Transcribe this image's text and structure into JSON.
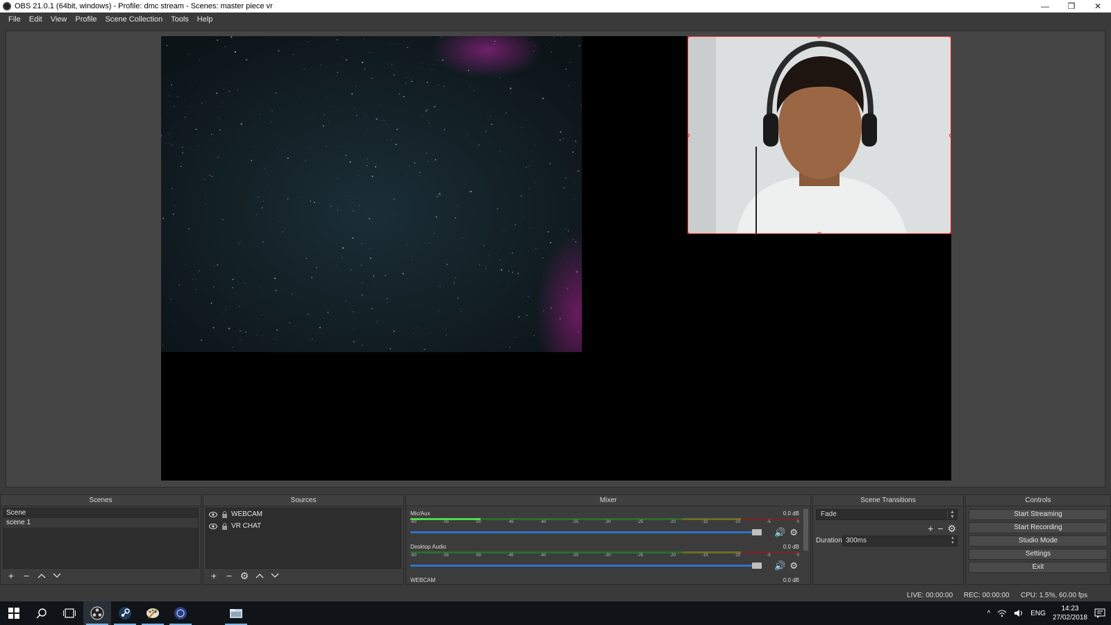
{
  "window": {
    "title": "OBS 21.0.1 (64bit, windows) - Profile: dmc stream - Scenes: master piece vr",
    "minimize": "—",
    "maximize": "❐",
    "close": "✕"
  },
  "menu": [
    "File",
    "Edit",
    "View",
    "Profile",
    "Scene Collection",
    "Tools",
    "Help"
  ],
  "docks": {
    "scenes": {
      "title": "Scenes",
      "items": [
        "Scene",
        "scene 1"
      ]
    },
    "sources": {
      "title": "Sources",
      "items": [
        "WEBCAM",
        "VR CHAT"
      ]
    },
    "mixer": {
      "title": "Mixer",
      "channels": [
        {
          "name": "Mic/Aux",
          "db": "0.0 dB",
          "level": 0.18,
          "volume": 1.0
        },
        {
          "name": "Desktop Audio",
          "db": "0.0 dB",
          "level": 0.0,
          "volume": 1.0
        },
        {
          "name": "WEBCAM",
          "db": "0.0 dB",
          "level": 0.0,
          "volume": 1.0
        }
      ],
      "ticks": [
        "-60",
        "-55",
        "-50",
        "-45",
        "-40",
        "-35",
        "-30",
        "-25",
        "-20",
        "-15",
        "-10",
        "-5",
        "0"
      ]
    },
    "transitions": {
      "title": "Scene Transitions",
      "selected": "Fade",
      "duration_label": "Duration",
      "duration_value": "300ms"
    },
    "controls": {
      "title": "Controls",
      "buttons": [
        "Start Streaming",
        "Start Recording",
        "Studio Mode",
        "Settings",
        "Exit"
      ]
    }
  },
  "status": {
    "live": "LIVE: 00:00:00",
    "rec": "REC: 00:00:00",
    "cpu": "CPU: 1.5%, 60.00 fps"
  },
  "taskbar": {
    "language": "ENG",
    "time": "14:23",
    "date": "27/02/2018"
  },
  "colors": {
    "selection_outline": "#e02020",
    "fader_blue": "#2f74c9",
    "meter_green": "#4ed84e"
  }
}
